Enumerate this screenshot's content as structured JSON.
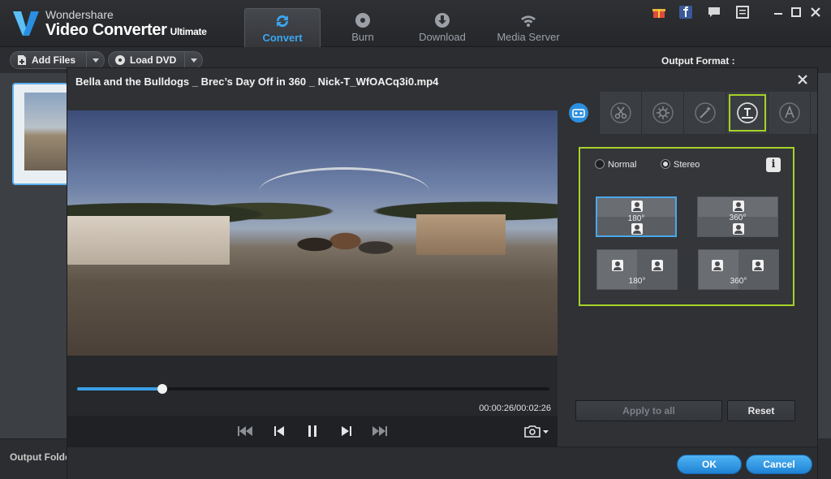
{
  "app": {
    "brand_top": "Wondershare",
    "brand_main": "Video Converter",
    "brand_edition": "Ultimate",
    "accent_color": "#3aa6f0"
  },
  "nav": {
    "tabs": [
      {
        "label": "Convert",
        "icon": "refresh-icon",
        "active": true
      },
      {
        "label": "Burn",
        "icon": "disc-icon",
        "active": false
      },
      {
        "label": "Download",
        "icon": "download-icon",
        "active": false
      },
      {
        "label": "Media Server",
        "icon": "wifi-icon",
        "active": false
      }
    ]
  },
  "toolbar": {
    "add_files": "Add Files",
    "load_dvd": "Load DVD",
    "output_format_label": "Output Format :"
  },
  "footer_main": {
    "output_folder_label": "Output Folder"
  },
  "dialog": {
    "title": "Bella and the Bulldogs _ Brec’s Day Off in 360 _ Nick-T_WfOACq3i0.mp4",
    "player": {
      "time_display": "00:00:26/00:02:26",
      "progress_fraction": 0.18
    },
    "panel_tabs": [
      {
        "icon": "vr-360-icon",
        "active": true
      },
      {
        "icon": "scissors-icon"
      },
      {
        "icon": "brightness-icon"
      },
      {
        "icon": "magic-wand-icon"
      },
      {
        "icon": "watermark-icon",
        "highlighted": true
      },
      {
        "icon": "text-icon"
      }
    ],
    "vr": {
      "normal_label": "Normal",
      "stereo_label": "Stereo",
      "selected_mode": "Stereo",
      "info_label": "i",
      "modes": [
        {
          "label": "180°",
          "layout": "top-bottom",
          "selected": true
        },
        {
          "label": "360°",
          "layout": "top-bottom",
          "selected": false
        },
        {
          "label": "180°",
          "layout": "left-right",
          "selected": false
        },
        {
          "label": "360°",
          "layout": "left-right",
          "selected": false
        }
      ]
    },
    "apply_to_all": "Apply to all",
    "reset": "Reset",
    "ok": "OK",
    "cancel": "Cancel"
  }
}
